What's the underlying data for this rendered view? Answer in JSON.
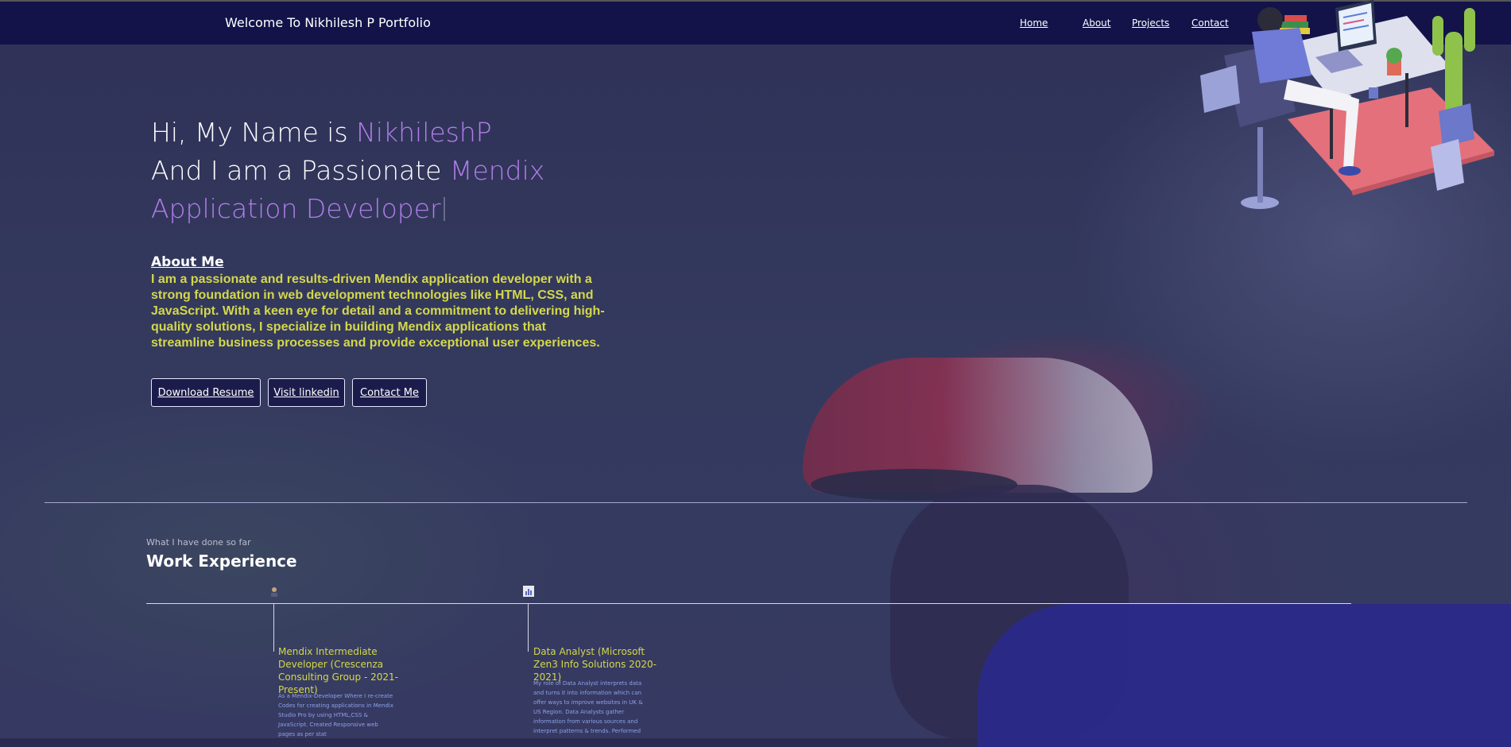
{
  "navbar": {
    "brand": "Welcome To Nikhilesh P Portfolio",
    "links": [
      "Home",
      "About",
      "Projects",
      "Contact"
    ]
  },
  "hero": {
    "line1_prefix": "Hi, My Name is ",
    "line1_name": "NikhileshP",
    "line2_prefix": "And I am a Passionate ",
    "line2_accent": "Mendix",
    "line3_accent": "Application Developer"
  },
  "about": {
    "title": "About Me",
    "text": "I am a passionate and results-driven Mendix application developer with a strong foundation in web development technologies like HTML, CSS, and JavaScript. With a keen eye for detail and a commitment to delivering high-quality solutions, I specialize in building Mendix applications that streamline business processes and provide exceptional user experiences."
  },
  "buttons": {
    "resume": "Download Resume",
    "linkedin": "Visit linkedin",
    "contact": "Contact Me"
  },
  "work": {
    "subtitle": "What I have done so far",
    "title": "Work Experience",
    "jobs": [
      {
        "title": "Mendix Intermediate Developer (Crescenza Consulting Group - 2021-Present)",
        "desc": "As a Mendix-Developer Where I re-create Codes for creating applications in Mendix Studio Pro by using HTML,CSS & JavaScript. Created Responsive web pages as per stat"
      },
      {
        "title": "Data Analyst (Microsoft Zen3 Info Solutions 2020-2021)",
        "desc": "My role of Data Analyst interprets data and turns it into information which can offer ways to improve websites in UK & US Region. Data Analysts gather information from various sources and interpret patterns & trends. Performed"
      }
    ]
  },
  "colors": {
    "navbar": "#13134a",
    "accent": "#b07ee8",
    "about_text": "#d4d84a",
    "job_desc": "#8ea0e8"
  },
  "icons": [
    "developer-illustration",
    "job-developer-icon",
    "job-analyst-icon"
  ]
}
